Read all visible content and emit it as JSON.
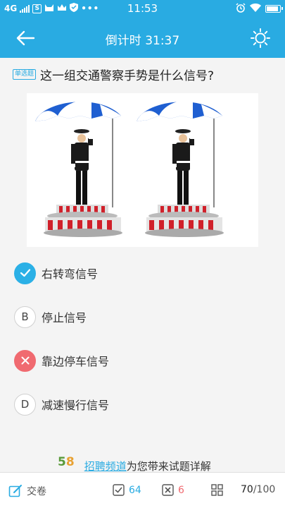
{
  "status_bar": {
    "network": "4G",
    "time": "11:53"
  },
  "header": {
    "title": "倒计时 31:37"
  },
  "question": {
    "type_tag": "单选题",
    "text": "这一组交通警察手势是什么信号?"
  },
  "options": [
    {
      "badge": "",
      "text": "右转弯信号",
      "state": "correct"
    },
    {
      "badge": "B",
      "text": "停止信号",
      "state": "normal"
    },
    {
      "badge": "",
      "text": "靠边停车信号",
      "state": "wrong"
    },
    {
      "badge": "D",
      "text": "减速慢行信号",
      "state": "normal"
    }
  ],
  "promo": {
    "logo_5": "5",
    "logo_8": "8",
    "link_text": "招聘频道",
    "suffix": "为您带来试题详解"
  },
  "bottom_bar": {
    "submit_label": "交卷",
    "correct_count": "64",
    "wrong_count": "6",
    "progress_current": "70",
    "progress_total": "/100"
  },
  "colors": {
    "primary": "#29abe2",
    "correct": "#2bb0e6",
    "wrong": "#f06a70"
  }
}
